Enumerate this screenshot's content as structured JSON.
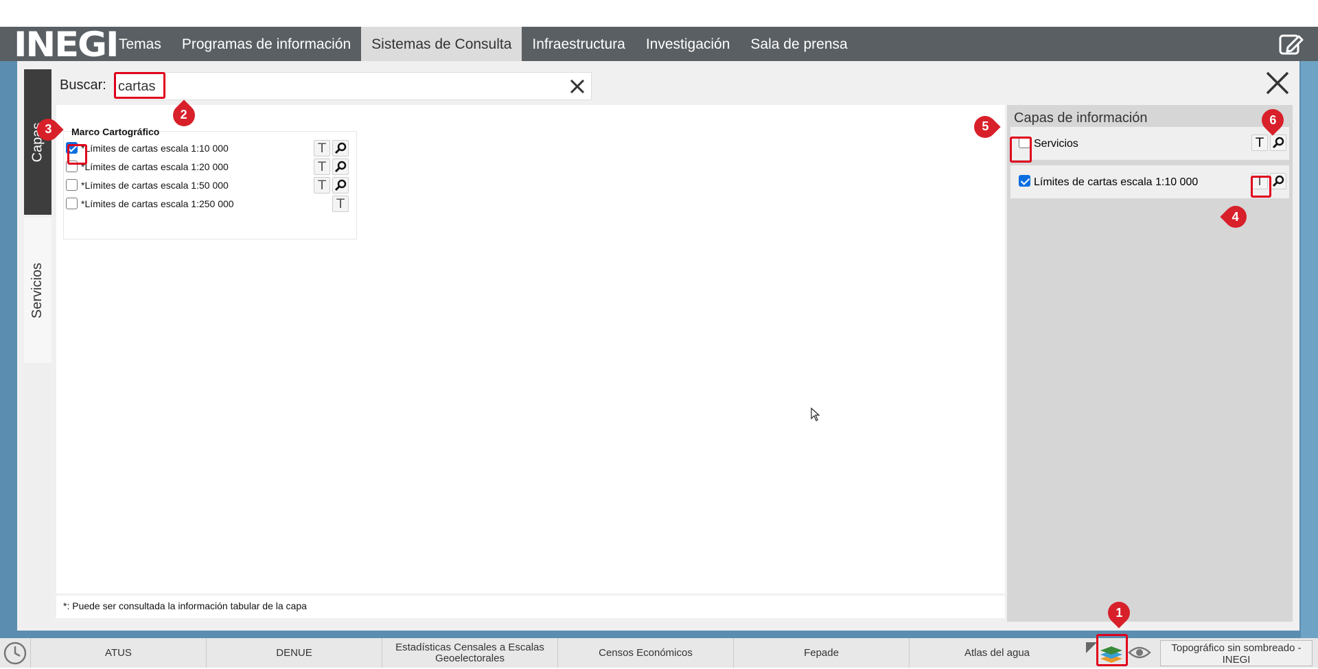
{
  "header": {
    "logo": "INEGI",
    "nav": [
      "Temas",
      "Programas de información",
      "Sistemas de Consulta",
      "Infraestructura",
      "Investigación",
      "Sala de prensa"
    ],
    "active_nav": 2,
    "edit_icon": "edit-icon"
  },
  "side_tabs": [
    "Capas",
    "Servicios"
  ],
  "search": {
    "label": "Buscar:",
    "value": "cartas"
  },
  "group": {
    "title": "Marco Cartográfico",
    "layers": [
      {
        "label": "Límites de cartas escala 1:10 000",
        "checked": true,
        "prefix": "*"
      },
      {
        "label": "Límites de cartas escala 1:20 000",
        "checked": false,
        "prefix": "*"
      },
      {
        "label": "Límites de cartas escala 1:50 000",
        "checked": false,
        "prefix": "*"
      },
      {
        "label": "Límites de cartas escala 1:250 000",
        "checked": false,
        "prefix": "*"
      }
    ]
  },
  "footnote": "*: Puede ser consultada la información tabular de la capa",
  "info_panel": {
    "title": "Capas de información",
    "rows": [
      {
        "label": "Servicios",
        "checked": false
      },
      {
        "label": "Límites de cartas escala 1:10 000",
        "checked": true
      }
    ]
  },
  "icons": {
    "table": "T",
    "zoom": "magnifier-icon"
  },
  "bottom_bar": {
    "items": [
      "ATUS",
      "DENUE",
      "Estadísticas Censales a Escalas Geoelectorales",
      "Censos Económicos",
      "Fepade",
      "Atlas del agua"
    ],
    "basemap": "Topográfico sin sombreado - INEGI"
  },
  "annotations": [
    "1",
    "2",
    "3",
    "4",
    "5",
    "6"
  ],
  "colors": {
    "highlight": "#e0001b",
    "pin": "#d8202a",
    "topbar": "#5a5f63",
    "checkbox": "#0b6fe0"
  }
}
